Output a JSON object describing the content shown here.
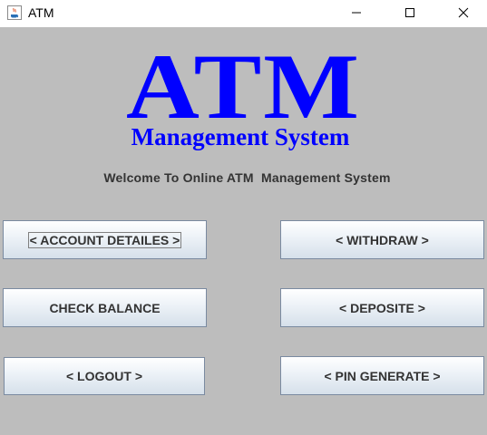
{
  "window": {
    "title": "ATM",
    "controls": {
      "minimize_icon": "minimize-icon",
      "maximize_icon": "maximize-icon",
      "close_icon": "close-icon"
    }
  },
  "logo": {
    "main": "ATM",
    "subtitle": "Management System",
    "color": "#0000ff"
  },
  "welcome_text": "Welcome To Online ATM  Management System",
  "buttons": {
    "account_details": "< ACCOUNT DETAILES >",
    "withdraw": "< WITHDRAW >",
    "check_balance": "CHECK BALANCE",
    "deposite": "< DEPOSITE >",
    "logout": "< LOGOUT >",
    "pin_generate": "< PIN GENERATE >"
  },
  "colors": {
    "background": "#bdbdbd",
    "button_text": "#333333"
  }
}
